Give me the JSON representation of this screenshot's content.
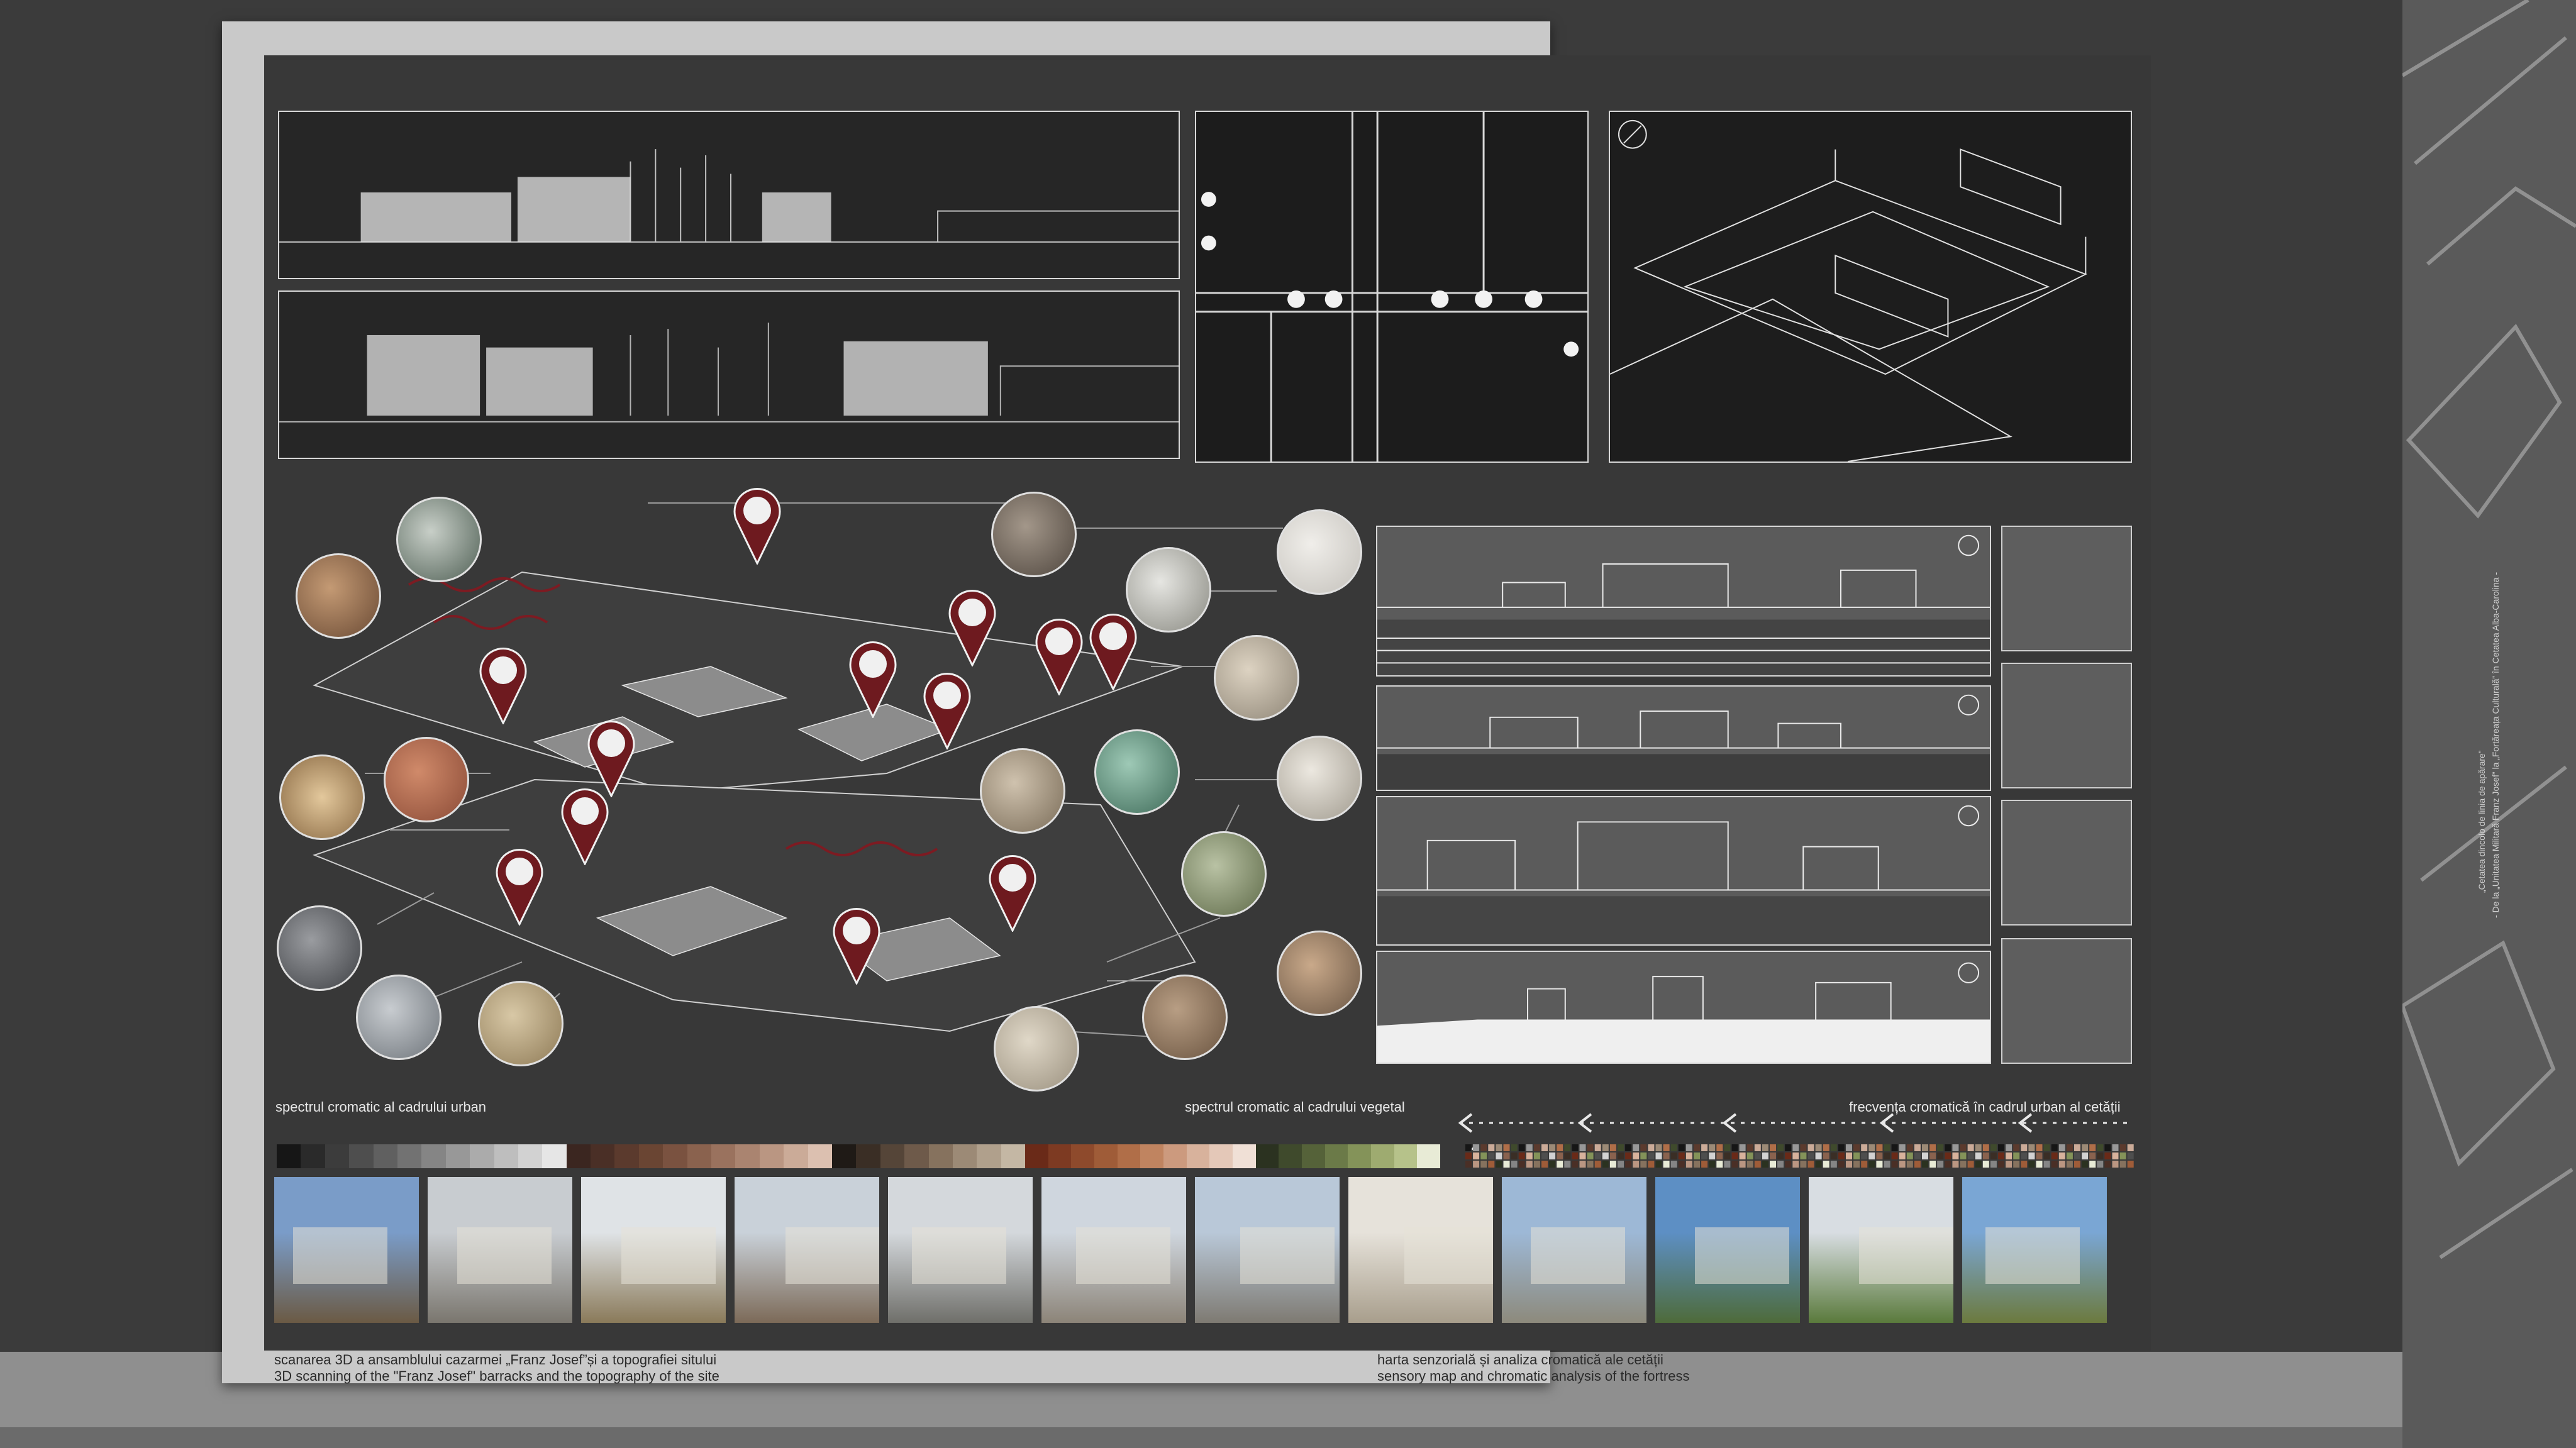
{
  "captions": {
    "left_ro": "scanarea 3D a ansamblului cazarmei „Franz Josef”și a topografiei sitului",
    "left_en": "3D scanning of the \"Franz Josef\" barracks and the topography of the site",
    "right_ro": "harta senzorială și analiza cromatică ale cetății",
    "right_en": "sensory map and chromatic analysis of the fortress"
  },
  "spectrum_labels": {
    "urban": "spectrul cromatic al cadrului urban",
    "vegetal": "spectrul cromatic al cadrului vegetal",
    "frequency": "frecvența cromatică în cadrul urban al cetății"
  },
  "colors": {
    "wall": "#3b3b3b",
    "board": "#c9c9c9",
    "panel": "#383838",
    "pin": "#6e1a1f",
    "line": "#e0e0e0"
  },
  "urban_swatches": [
    "#161616",
    "#2a2a2a",
    "#3c3c3c",
    "#4e4e4e",
    "#606060",
    "#727272",
    "#858585",
    "#989898",
    "#ababab",
    "#bebebe",
    "#d2d2d2",
    "#e6e6e6",
    "#3b2620",
    "#4a2f26",
    "#5b3a2d",
    "#6a4533",
    "#7a5240",
    "#8a624e",
    "#9a725e",
    "#aa8470",
    "#ba9682",
    "#cbab98",
    "#dcc0b0",
    "#1f1a16",
    "#3a2e25",
    "#554538",
    "#6e5a4a",
    "#86725e",
    "#9c8a76",
    "#b0a08c",
    "#c4b7a4"
  ],
  "vegetal_swatches": [
    "#6a2a18",
    "#7d3a22",
    "#8e4a2c",
    "#9f5c38",
    "#b06e48",
    "#c08460",
    "#cc9a7e",
    "#d8b29c",
    "#e4c8b8",
    "#f0e0d6",
    "#2b3220",
    "#3f4a2c",
    "#556239",
    "#6b7a48",
    "#849359",
    "#9eab70",
    "#b6c28a",
    "#e8ebd6"
  ],
  "photos": [
    {
      "sky": "#7a9cc8",
      "ground": "#6b5a44"
    },
    {
      "sky": "#c8ccd0",
      "ground": "#7a766e"
    },
    {
      "sky": "#dfe3e6",
      "ground": "#8a7a5a"
    },
    {
      "sky": "#c9d1d9",
      "ground": "#7c6a58"
    },
    {
      "sky": "#d4d8dc",
      "ground": "#6f6f6a"
    },
    {
      "sky": "#cfd6de",
      "ground": "#8c8478"
    },
    {
      "sky": "#b9c8d8",
      "ground": "#7e7a72"
    },
    {
      "sky": "#e6e2da",
      "ground": "#a89e8c"
    },
    {
      "sky": "#9db8d6",
      "ground": "#8d8a7c"
    },
    {
      "sky": "#5d8fc4",
      "ground": "#4e6b3a"
    },
    {
      "sky": "#d8dde2",
      "ground": "#5a7a3c"
    },
    {
      "sky": "#7aa6d4",
      "ground": "#6c7a3e"
    }
  ],
  "side_text": {
    "line1": "„Cetatea dincolo de linia de apărare”",
    "line2": "- De la „Unitatea Militară Franz Josef” la „Fortăreața Culturală” în Cetatea Alba-Carolina -"
  }
}
